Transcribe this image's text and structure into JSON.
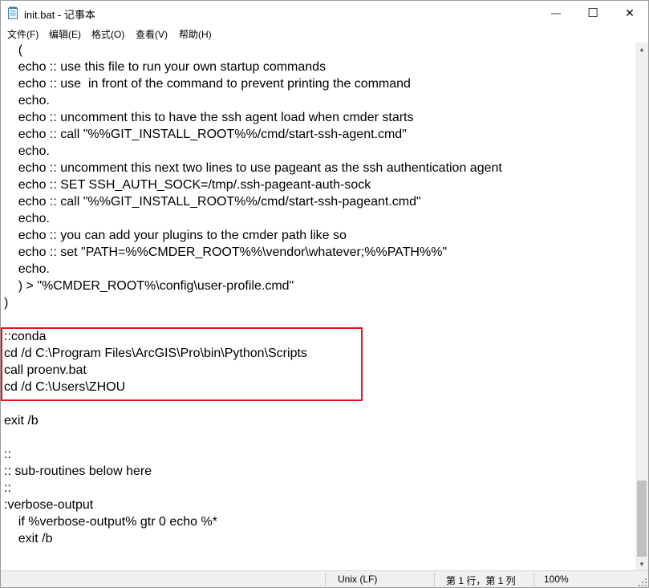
{
  "window": {
    "title": "init.bat - 记事本",
    "minimize_glyph": "—",
    "maximize_glyph": "☐",
    "close_glyph": "✕"
  },
  "menu": {
    "file": "文件(F)",
    "edit": "编辑(E)",
    "format": "格式(O)",
    "view": "查看(V)",
    "help": "帮助(H)"
  },
  "editor": {
    "lines": [
      "    (",
      "    echo :: use this file to run your own startup commands",
      "    echo :: use  in front of the command to prevent printing the command",
      "    echo.",
      "    echo :: uncomment this to have the ssh agent load when cmder starts",
      "    echo :: call \"%%GIT_INSTALL_ROOT%%/cmd/start-ssh-agent.cmd\"",
      "    echo.",
      "    echo :: uncomment this next two lines to use pageant as the ssh authentication agent",
      "    echo :: SET SSH_AUTH_SOCK=/tmp/.ssh-pageant-auth-sock",
      "    echo :: call \"%%GIT_INSTALL_ROOT%%/cmd/start-ssh-pageant.cmd\"",
      "    echo.",
      "    echo :: you can add your plugins to the cmder path like so",
      "    echo :: set \"PATH=%%CMDER_ROOT%%\\vendor\\whatever;%%PATH%%\"",
      "    echo.",
      "    ) > \"%CMDER_ROOT%\\config\\user-profile.cmd\"",
      ")",
      "",
      "::conda",
      "cd /d C:\\Program Files\\ArcGIS\\Pro\\bin\\Python\\Scripts",
      "call proenv.bat",
      "cd /d C:\\Users\\ZHOU",
      "",
      "exit /b",
      "",
      "::",
      ":: sub-routines below here",
      "::",
      ":verbose-output",
      "    if %verbose-output% gtr 0 echo %*",
      "    exit /b"
    ]
  },
  "scrollbar": {
    "up_glyph": "▲",
    "down_glyph": "▼"
  },
  "status": {
    "line_ending": "Unix (LF)",
    "position": "第 1 行，第 1 列",
    "zoom": "100%"
  }
}
